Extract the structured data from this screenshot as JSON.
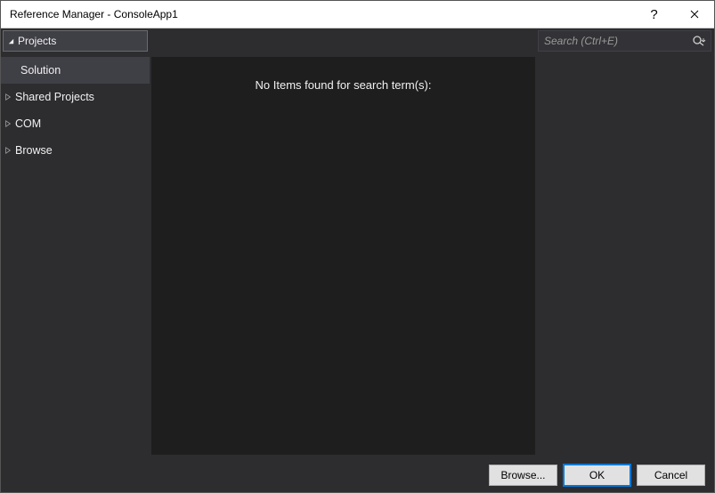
{
  "window": {
    "title": "Reference Manager - ConsoleApp1"
  },
  "topstrip": {
    "active_category": "Projects"
  },
  "search": {
    "placeholder": "Search (Ctrl+E)",
    "value": ""
  },
  "sidebar": {
    "items": [
      {
        "label": "Solution",
        "level": "sub",
        "expanded": false,
        "selected": true
      },
      {
        "label": "Shared Projects",
        "level": "root",
        "expanded": false,
        "selected": false
      },
      {
        "label": "COM",
        "level": "root",
        "expanded": false,
        "selected": false
      },
      {
        "label": "Browse",
        "level": "root",
        "expanded": false,
        "selected": false
      }
    ]
  },
  "content": {
    "empty_message": "No Items found for search term(s):"
  },
  "footer": {
    "browse": "Browse...",
    "ok": "OK",
    "cancel": "Cancel"
  }
}
